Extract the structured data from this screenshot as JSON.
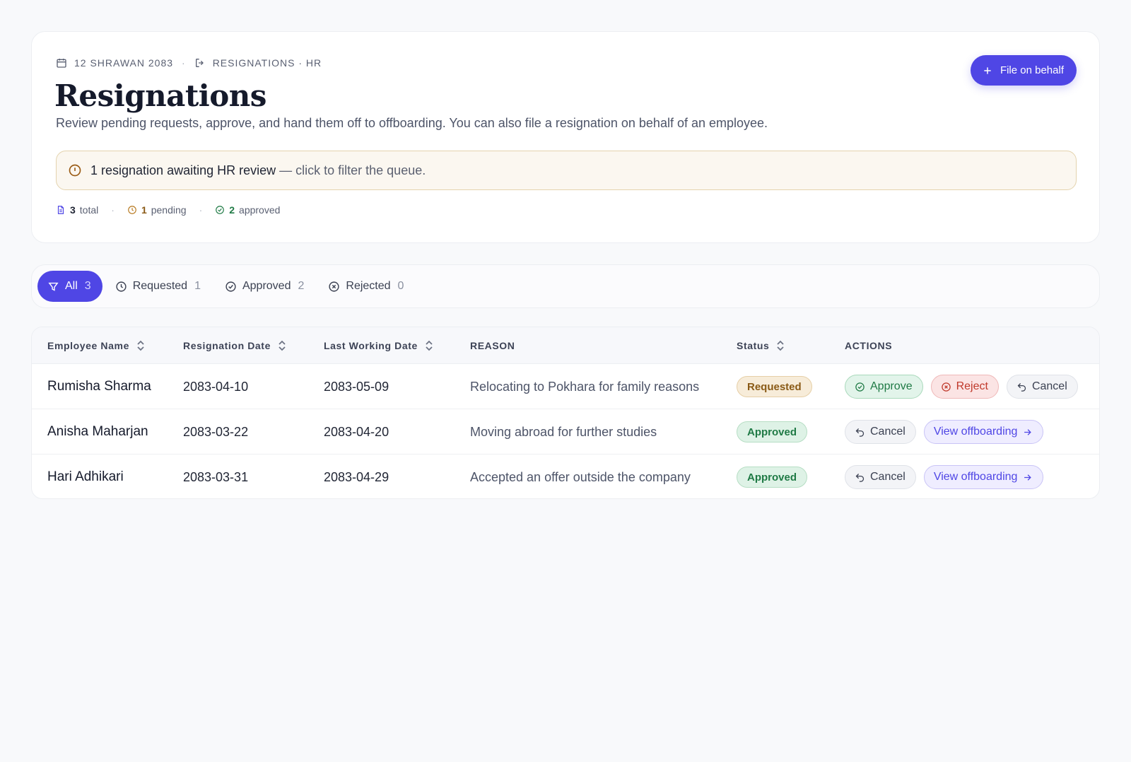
{
  "header": {
    "date": "12 SHRAWAN 2083",
    "section": "RESIGNATIONS · HR",
    "title": "Resignations",
    "subtitle": "Review pending requests, approve, and hand them off to offboarding. You can also file a resignation on behalf of an employee.",
    "primary_button": "File on behalf"
  },
  "alert": {
    "strong_text": "1 resignation awaiting HR review",
    "rest_text": " — click to filter the queue."
  },
  "stats": {
    "total": {
      "count": "3",
      "label": "total"
    },
    "pending": {
      "count": "1",
      "label": "pending"
    },
    "approved": {
      "count": "2",
      "label": "approved"
    }
  },
  "filters": [
    {
      "label": "All",
      "count": "3",
      "active": true
    },
    {
      "label": "Requested",
      "count": "1",
      "active": false
    },
    {
      "label": "Approved",
      "count": "2",
      "active": false
    },
    {
      "label": "Rejected",
      "count": "0",
      "active": false
    }
  ],
  "table": {
    "columns": [
      "Employee Name",
      "Resignation Date",
      "Last Working Date",
      "REASON",
      "Status",
      "ACTIONS"
    ],
    "rows": [
      {
        "name": "Rumisha Sharma",
        "resignation_date": "2083-04-10",
        "last_working_date": "2083-05-09",
        "reason": "Relocating to Pokhara for family reasons",
        "status": "Requested",
        "actions": [
          "Approve",
          "Reject",
          "Cancel"
        ]
      },
      {
        "name": "Anisha Maharjan",
        "resignation_date": "2083-03-22",
        "last_working_date": "2083-04-20",
        "reason": "Moving abroad for further studies",
        "status": "Approved",
        "actions": [
          "Cancel",
          "View offboarding"
        ]
      },
      {
        "name": "Hari Adhikari",
        "resignation_date": "2083-03-31",
        "last_working_date": "2083-04-29",
        "reason": "Accepted an offer outside the company",
        "status": "Approved",
        "actions": [
          "Cancel",
          "View offboarding"
        ]
      }
    ]
  },
  "colors": {
    "accent": "#4f46e5",
    "requested": "#8a5a16",
    "approved": "#1f7a45",
    "reject": "#c0392b",
    "alert_border": "#e4d3ae"
  },
  "icons": {
    "date": "calendar-icon",
    "section": "logout-icon",
    "primary_button": "plus-icon",
    "alert": "alert-circle-icon",
    "total": "document-icon",
    "pending": "clock-icon",
    "approved": "check-circle-icon",
    "filter_all": "funnel-icon",
    "filter_requested": "clock-icon",
    "filter_approved": "check-circle-icon",
    "filter_rejected": "x-circle-icon",
    "sort": "sort-icon",
    "approve": "check-circle-icon",
    "reject": "x-circle-icon",
    "cancel": "undo-icon",
    "view": "arrow-right-icon"
  }
}
